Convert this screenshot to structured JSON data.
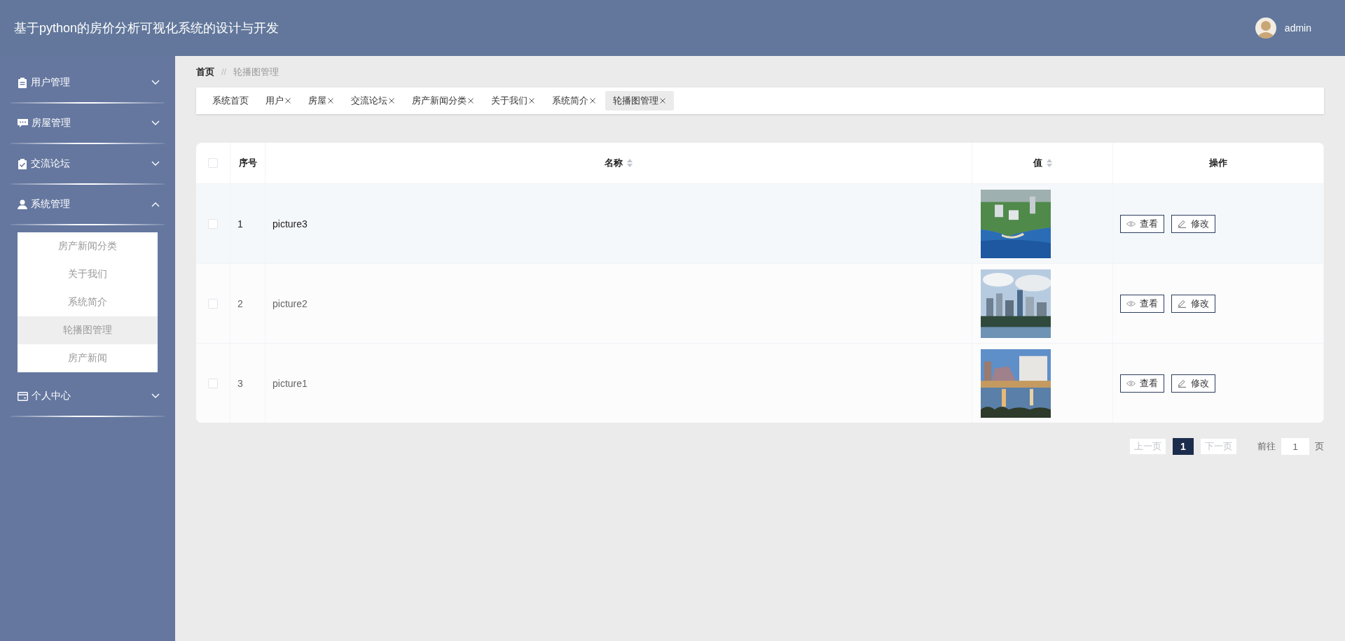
{
  "header": {
    "title": "基于python的房价分析可视化系统的设计与开发",
    "user": {
      "name": "admin"
    }
  },
  "sidebar": {
    "menus": [
      {
        "label": "用户管理",
        "expanded": false
      },
      {
        "label": "房屋管理",
        "expanded": false
      },
      {
        "label": "交流论坛",
        "expanded": false
      },
      {
        "label": "系统管理",
        "expanded": true,
        "children": [
          {
            "label": "房产新闻分类",
            "selected": false
          },
          {
            "label": "关于我们",
            "selected": false
          },
          {
            "label": "系统简介",
            "selected": false
          },
          {
            "label": "轮播图管理",
            "selected": true
          },
          {
            "label": "房产新闻",
            "selected": false
          }
        ]
      },
      {
        "label": "个人中心",
        "expanded": false
      }
    ]
  },
  "breadcrumb": {
    "items": [
      "首页",
      "轮播图管理"
    ],
    "separator": "//"
  },
  "tabs": [
    {
      "label": "系统首页",
      "closable": false,
      "selected": false
    },
    {
      "label": "用户",
      "closable": true,
      "selected": false
    },
    {
      "label": "房屋",
      "closable": true,
      "selected": false
    },
    {
      "label": "交流论坛",
      "closable": true,
      "selected": false
    },
    {
      "label": "房产新闻分类",
      "closable": true,
      "selected": false
    },
    {
      "label": "关于我们",
      "closable": true,
      "selected": false
    },
    {
      "label": "系统简介",
      "closable": true,
      "selected": false
    },
    {
      "label": "轮播图管理",
      "closable": true,
      "selected": true
    }
  ],
  "table": {
    "select_all_checked": false,
    "columns": [
      {
        "label": "序号",
        "sortable": false
      },
      {
        "label": "名称",
        "sortable": true
      },
      {
        "label": "值",
        "sortable": true
      },
      {
        "label": "操作",
        "sortable": false
      }
    ],
    "rows": [
      {
        "checked": false,
        "hovered": true,
        "index": "1",
        "name": "picture3",
        "value": {
          "kind": "picture"
        },
        "actions": [
          {
            "kind": "view",
            "label": "查看"
          },
          {
            "kind": "edit",
            "label": "修改"
          }
        ]
      },
      {
        "checked": false,
        "hovered": false,
        "index": "2",
        "name": "picture2",
        "value": {
          "kind": "picture"
        },
        "actions": [
          {
            "kind": "view",
            "label": "查看"
          },
          {
            "kind": "edit",
            "label": "修改"
          }
        ]
      },
      {
        "checked": false,
        "hovered": false,
        "index": "3",
        "name": "picture1",
        "value": {
          "kind": "picture"
        },
        "actions": [
          {
            "kind": "view",
            "label": "查看"
          },
          {
            "kind": "edit",
            "label": "修改"
          }
        ]
      }
    ]
  },
  "pagination": {
    "prev": {
      "label": "上一页",
      "disabled": true
    },
    "pages": [
      {
        "label": "1",
        "selected": true
      }
    ],
    "next": {
      "label": "下一页",
      "disabled": true
    },
    "goto_label": "前往",
    "goto_value": "1",
    "goto_suffix": "页"
  }
}
